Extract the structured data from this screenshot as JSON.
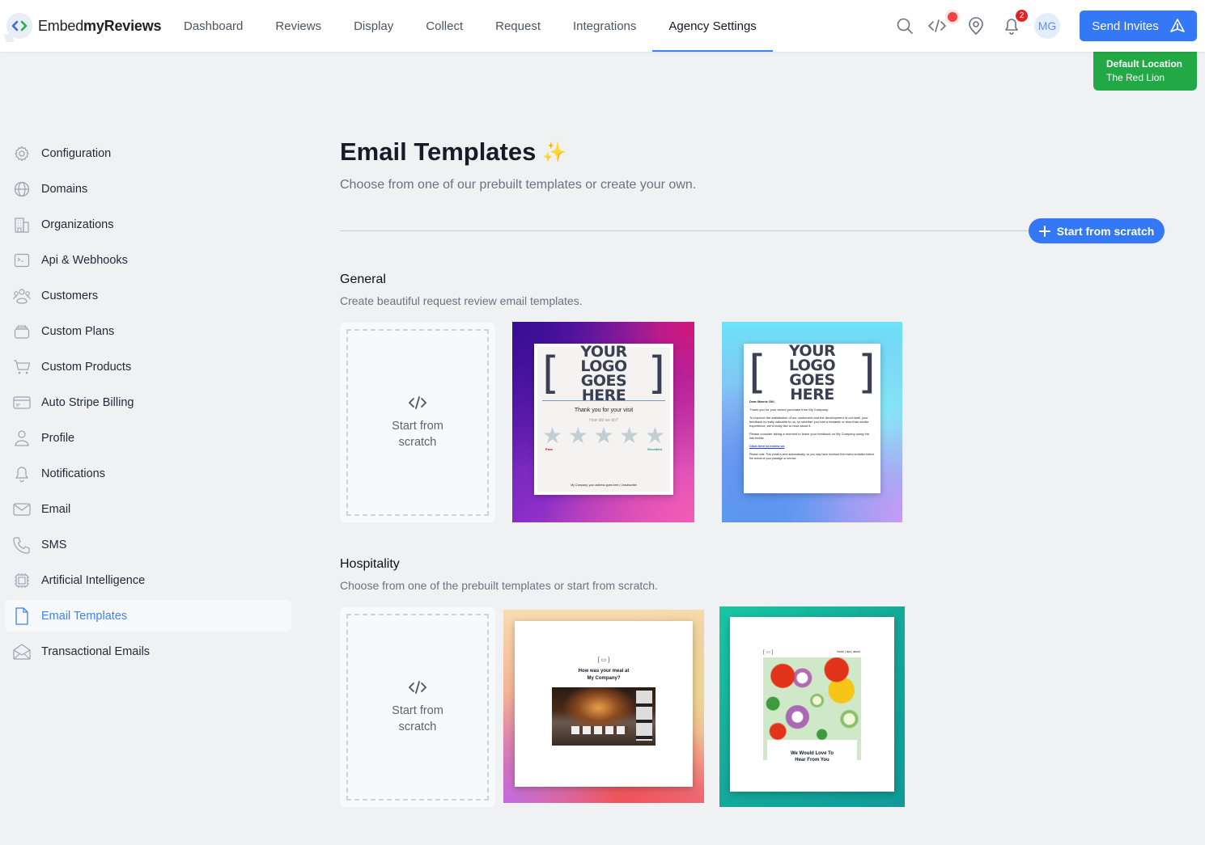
{
  "app": {
    "brand_light": "Embed",
    "brand_bold": "myReviews",
    "accent_color": "#3478f6",
    "success_color": "#22a845"
  },
  "nav": {
    "items": [
      {
        "label": "Dashboard"
      },
      {
        "label": "Reviews"
      },
      {
        "label": "Display"
      },
      {
        "label": "Collect"
      },
      {
        "label": "Request"
      },
      {
        "label": "Integrations"
      },
      {
        "label": "Agency Settings",
        "active": true
      }
    ]
  },
  "header": {
    "notifications_count": "2",
    "avatar_initials": "MG",
    "send_invites_label": "Send Invites",
    "location_title": "Default Location",
    "location_name": "The Red Lion"
  },
  "sidebar": {
    "items": [
      {
        "label": "Configuration",
        "icon": "gear-icon"
      },
      {
        "label": "Domains",
        "icon": "globe-icon"
      },
      {
        "label": "Organizations",
        "icon": "building-icon"
      },
      {
        "label": "Api & Webhooks",
        "icon": "terminal-icon"
      },
      {
        "label": "Customers",
        "icon": "users-icon"
      },
      {
        "label": "Custom Plans",
        "icon": "stack-icon"
      },
      {
        "label": "Custom Products",
        "icon": "cart-icon"
      },
      {
        "label": "Auto Stripe Billing",
        "icon": "credit-card-icon"
      },
      {
        "label": "Profile",
        "icon": "user-icon"
      },
      {
        "label": "Notifications",
        "icon": "bell-icon"
      },
      {
        "label": "Email",
        "icon": "mail-icon"
      },
      {
        "label": "SMS",
        "icon": "phone-icon"
      },
      {
        "label": "Artificial Intelligence",
        "icon": "chip-icon"
      },
      {
        "label": "Email Templates",
        "icon": "document-icon",
        "active": true
      },
      {
        "label": "Transactional Emails",
        "icon": "mail-open-icon"
      }
    ]
  },
  "main": {
    "title": "Email Templates",
    "title_emoji": "✨",
    "subtitle": "Choose from one of our prebuilt templates or create your own.",
    "start_scratch_button": "Start from scratch",
    "sections": [
      {
        "title": "General",
        "subtitle": "Create beautiful request review email templates.",
        "scratch_card_label": "Start from scratch",
        "templates": [
          {
            "name": "Star rating",
            "logo_line1": "YOUR LOGO",
            "logo_line2": "GOES HERE",
            "heading": "Thank you for your visit",
            "question": "How did we do?",
            "low_label": "Poor",
            "high_label": "Excellent",
            "footer": "My Company, your address goes here | Unsubscribe",
            "stars": 5
          },
          {
            "name": "Letter",
            "logo_line1": "YOUR LOGO",
            "logo_line2": "GOES HERE",
            "greeting": "Dear Marnie Gill,",
            "p1": "Thank you for your recent purchase from My Company.",
            "p2": "To improve the satisfaction of our customers and the development of our staff, your feedback is really valuable to us, so whether you had a fantastic or less-than-stellar experience, we'd really like to hear about it.",
            "p3": "Please consider taking a moment to leave your feedback on My Company using the link below.",
            "link": "Click here to review us",
            "note": "Please note: This email is sent automatically, so you may have received this review invitation before the arrival of your package or service."
          }
        ]
      },
      {
        "title": "Hospitality",
        "subtitle": "Choose from one of the prebuilt templates or start from scratch.",
        "scratch_card_label": "Start from scratch",
        "templates": [
          {
            "name": "Restaurant",
            "heading_line1": "How was your meal at",
            "heading_line2": "My Company?"
          },
          {
            "name": "Fresh food",
            "nav_links": "home | tips | about",
            "heading_line1": "We Would Love To",
            "heading_line2": "Hear From You"
          }
        ]
      }
    ]
  }
}
